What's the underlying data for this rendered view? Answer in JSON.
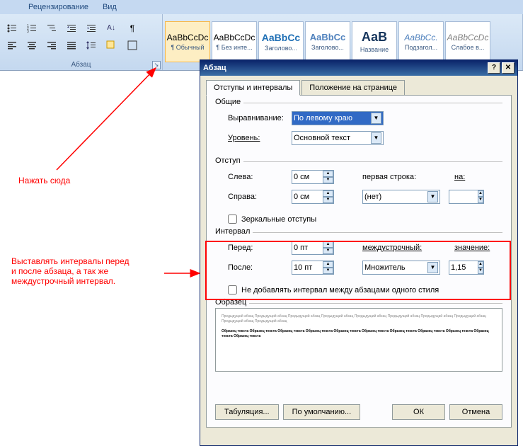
{
  "ribbon": {
    "tabs": [
      "Рецензирование",
      "Вид"
    ],
    "paragraph_group": "Абзац",
    "styles": [
      {
        "preview": "AaBbCcDc",
        "name": "¶ Обычный",
        "selected": true,
        "color": "#000",
        "size": "12px"
      },
      {
        "preview": "AaBbCcDc",
        "name": "¶ Без инте...",
        "selected": false,
        "color": "#000",
        "size": "12px"
      },
      {
        "preview": "AaBbCc",
        "name": "Заголово...",
        "selected": false,
        "color": "#1f6fb5",
        "size": "14px",
        "bold": true
      },
      {
        "preview": "AaBbCc",
        "name": "Заголово...",
        "selected": false,
        "color": "#4f81bd",
        "size": "13px",
        "bold": true
      },
      {
        "preview": "АаВ",
        "name": "Название",
        "selected": false,
        "color": "#17365d",
        "size": "18px",
        "bold": true
      },
      {
        "preview": "AaBbCc.",
        "name": "Подзагол...",
        "selected": false,
        "color": "#4f81bd",
        "size": "12px",
        "italic": true
      },
      {
        "preview": "AaBbCcDc",
        "name": "Слабое в...",
        "selected": false,
        "color": "#808080",
        "size": "12px",
        "italic": true
      }
    ]
  },
  "dialog": {
    "title": "Абзац",
    "tabs": [
      "Отступы и интервалы",
      "Положение на странице"
    ],
    "section_general": "Общие",
    "alignment_label": "Выравнивание:",
    "alignment_value": "По левому краю",
    "level_label": "Уровень:",
    "level_value": "Основной текст",
    "section_indent": "Отступ",
    "left_label": "Слева:",
    "left_value": "0 см",
    "right_label": "Справа:",
    "right_value": "0 см",
    "firstline_label": "первая строка:",
    "firstline_value": "(нет)",
    "by_label": "на:",
    "by_value": "",
    "mirror_label": "Зеркальные отступы",
    "section_spacing": "Интервал",
    "before_label": "Перед:",
    "before_value": "0 пт",
    "after_label": "После:",
    "after_value": "10 пт",
    "linespacing_label": "междустрочный:",
    "linespacing_value": "Множитель",
    "at_label": "значение:",
    "at_value": "1,15",
    "nosame_label": "Не добавлять интервал между абзацами одного стиля",
    "section_preview": "Образец",
    "btn_tabs": "Табуляция...",
    "btn_default": "По умолчанию...",
    "btn_ok": "ОК",
    "btn_cancel": "Отмена"
  },
  "annotations": {
    "click_here": "Нажать сюда",
    "spacing_note": "Выставлять интервалы перед\nи после абзаца, а так же\nмеждустрочный интервал."
  }
}
